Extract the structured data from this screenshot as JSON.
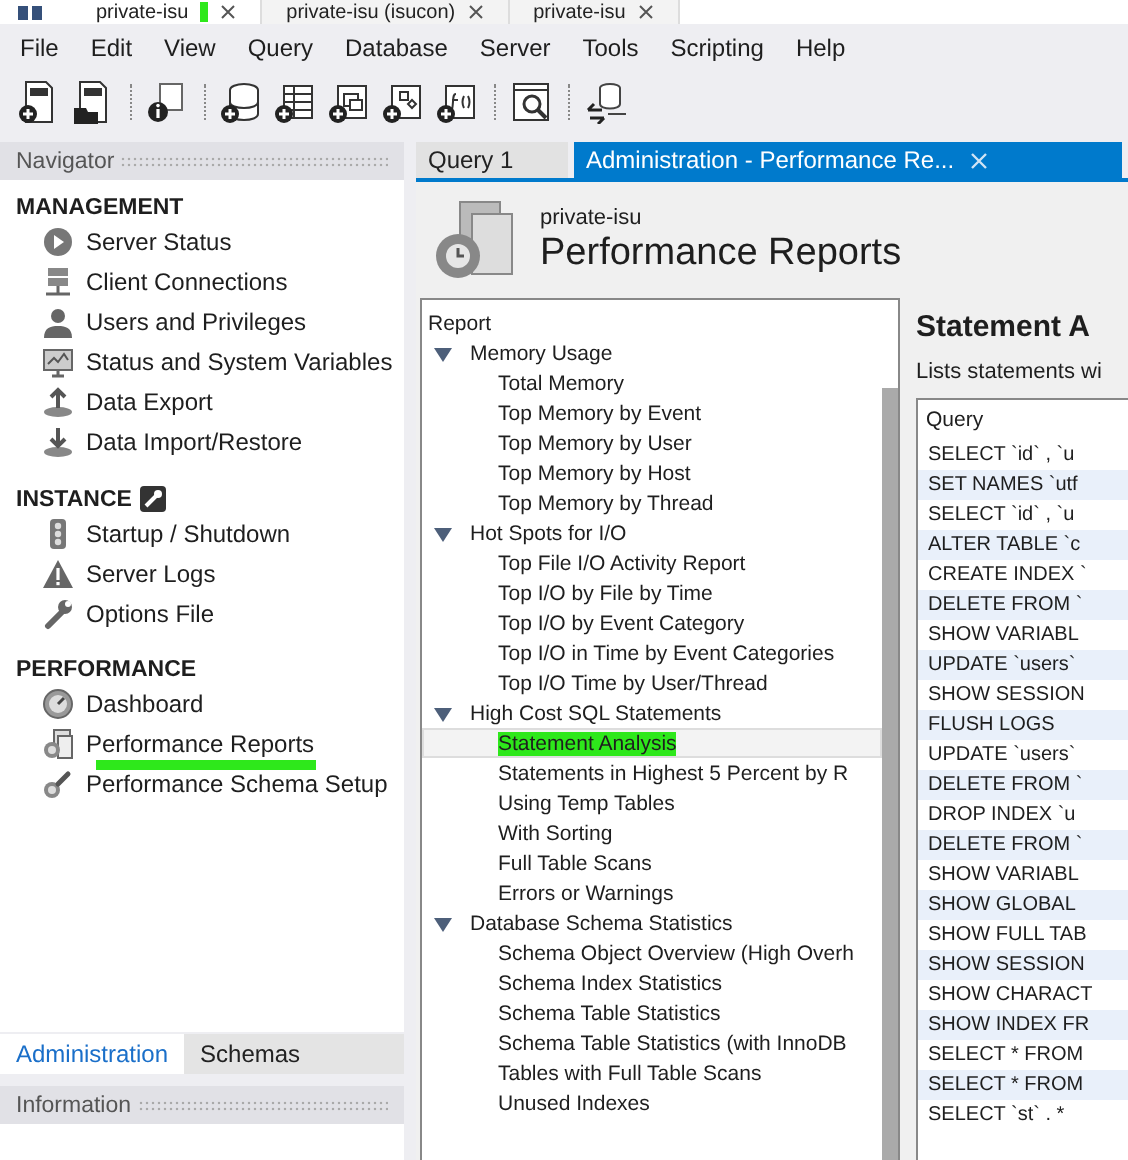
{
  "window_tabs": [
    {
      "title": "private-isu",
      "selected": true
    },
    {
      "title": "private-isu (isucon)",
      "selected": false
    },
    {
      "title": "private-isu",
      "selected": false
    }
  ],
  "menu": [
    "File",
    "Edit",
    "View",
    "Query",
    "Database",
    "Server",
    "Tools",
    "Scripting",
    "Help"
  ],
  "toolbar": [
    {
      "kind": "new-sql"
    },
    {
      "kind": "open-sql"
    },
    {
      "kind": "separator"
    },
    {
      "kind": "info"
    },
    {
      "kind": "separator"
    },
    {
      "kind": "new-schema"
    },
    {
      "kind": "new-table"
    },
    {
      "kind": "new-view"
    },
    {
      "kind": "new-routine"
    },
    {
      "kind": "new-function"
    },
    {
      "kind": "separator"
    },
    {
      "kind": "search"
    },
    {
      "kind": "separator"
    },
    {
      "kind": "reconnect"
    }
  ],
  "navigator": {
    "title": "Navigator",
    "sections": [
      {
        "title": "MANAGEMENT",
        "items": [
          {
            "label": "Server Status",
            "highlighted": false
          },
          {
            "label": "Client Connections",
            "highlighted": false
          },
          {
            "label": "Users and Privileges",
            "highlighted": false
          },
          {
            "label": "Status and System Variables",
            "highlighted": false
          },
          {
            "label": "Data Export",
            "highlighted": false
          },
          {
            "label": "Data Import/Restore",
            "highlighted": false
          }
        ]
      },
      {
        "title": "INSTANCE",
        "items": [
          {
            "label": "Startup / Shutdown",
            "highlighted": false
          },
          {
            "label": "Server Logs",
            "highlighted": false
          },
          {
            "label": "Options File",
            "highlighted": false
          }
        ]
      },
      {
        "title": "PERFORMANCE",
        "items": [
          {
            "label": "Dashboard",
            "highlighted": false
          },
          {
            "label": "Performance Reports",
            "highlighted": true
          },
          {
            "label": "Performance Schema Setup",
            "highlighted": false
          }
        ]
      }
    ],
    "tabs": [
      {
        "label": "Administration",
        "selected": true
      },
      {
        "label": "Schemas",
        "selected": false
      }
    ],
    "info_title": "Information"
  },
  "editor_tabs": [
    {
      "label": "Query 1",
      "selected": false
    },
    {
      "label": "Administration - Performance Re...",
      "selected": true
    }
  ],
  "header": {
    "subtitle": "private-isu",
    "title": "Performance Reports"
  },
  "report_tree": {
    "heading": "Report",
    "groups": [
      {
        "label": "Memory Usage",
        "expanded": true,
        "children": [
          {
            "label": "Total Memory",
            "selected": false,
            "highlighted": false
          },
          {
            "label": "Top Memory by Event",
            "selected": false,
            "highlighted": false
          },
          {
            "label": "Top Memory by User",
            "selected": false,
            "highlighted": false
          },
          {
            "label": "Top Memory by Host",
            "selected": false,
            "highlighted": false
          },
          {
            "label": "Top Memory by Thread",
            "selected": false,
            "highlighted": false
          }
        ]
      },
      {
        "label": "Hot Spots for I/O",
        "expanded": true,
        "children": [
          {
            "label": "Top File I/O Activity Report",
            "selected": false,
            "highlighted": false
          },
          {
            "label": "Top I/O by File by Time",
            "selected": false,
            "highlighted": false
          },
          {
            "label": "Top I/O by Event Category",
            "selected": false,
            "highlighted": false
          },
          {
            "label": "Top I/O in Time by Event Categories",
            "selected": false,
            "highlighted": false
          },
          {
            "label": "Top I/O Time by User/Thread",
            "selected": false,
            "highlighted": false
          }
        ]
      },
      {
        "label": "High Cost SQL Statements",
        "expanded": true,
        "children": [
          {
            "label": "Statement Analysis",
            "selected": true,
            "highlighted": true
          },
          {
            "label": "Statements in Highest 5 Percent by R",
            "selected": false,
            "highlighted": false
          },
          {
            "label": "Using Temp Tables",
            "selected": false,
            "highlighted": false
          },
          {
            "label": "With Sorting",
            "selected": false,
            "highlighted": false
          },
          {
            "label": "Full Table Scans",
            "selected": false,
            "highlighted": false
          },
          {
            "label": "Errors or Warnings",
            "selected": false,
            "highlighted": false
          }
        ]
      },
      {
        "label": "Database Schema Statistics",
        "expanded": true,
        "children": [
          {
            "label": "Schema Object Overview (High Overh",
            "selected": false,
            "highlighted": false
          },
          {
            "label": "Schema Index Statistics",
            "selected": false,
            "highlighted": false
          },
          {
            "label": "Schema Table Statistics",
            "selected": false,
            "highlighted": false
          },
          {
            "label": "Schema Table Statistics (with InnoDB",
            "selected": false,
            "highlighted": false
          },
          {
            "label": "Tables with Full Table Scans",
            "selected": false,
            "highlighted": false
          },
          {
            "label": "Unused Indexes",
            "selected": false,
            "highlighted": false
          }
        ]
      }
    ]
  },
  "statement": {
    "title": "Statement A",
    "description": "Lists statements wi",
    "column": "Query",
    "rows": [
      "SELECT `id` , `u",
      "SET NAMES `utf",
      "SELECT `id` , `u",
      "ALTER TABLE `c",
      "CREATE INDEX `",
      "DELETE FROM `",
      "SHOW VARIABL",
      "UPDATE `users`",
      "SHOW SESSION",
      "FLUSH LOGS",
      "UPDATE `users`",
      "DELETE FROM `",
      "DROP INDEX `u",
      "DELETE FROM `",
      "SHOW VARIABL",
      "SHOW GLOBAL",
      "SHOW FULL TAB",
      "SHOW SESSION",
      "SHOW CHARACT",
      "SHOW INDEX FR",
      "SELECT * FROM",
      "SELECT * FROM",
      "SELECT `st` . *"
    ]
  }
}
